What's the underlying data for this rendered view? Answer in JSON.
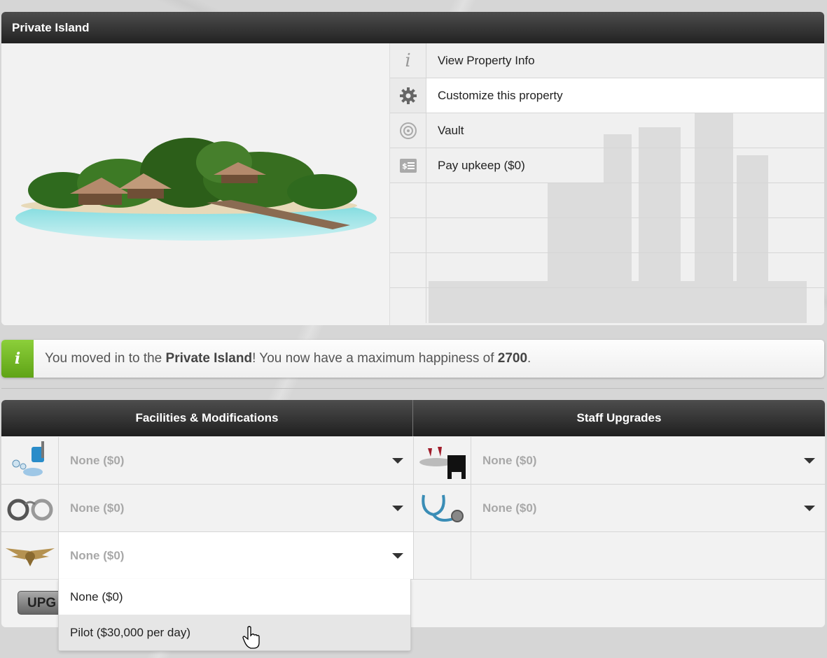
{
  "property": {
    "title": "Private Island",
    "menu": [
      {
        "icon": "info-icon",
        "label": "View Property Info"
      },
      {
        "icon": "gear-icon",
        "label": "Customize this property"
      },
      {
        "icon": "vault-icon",
        "label": "Vault"
      },
      {
        "icon": "upkeep-icon",
        "label": "Pay upkeep ($0)"
      }
    ]
  },
  "message": {
    "prefix": "You moved in to the ",
    "property_name": "Private Island",
    "middle": "! You now have a maximum happiness of ",
    "happiness": "2700",
    "suffix": "."
  },
  "upgrades": {
    "facilities_title": "Facilities & Modifications",
    "staff_title": "Staff Upgrades",
    "facilities": [
      {
        "icon": "cleaning-icon",
        "value": "None ($0)"
      },
      {
        "icon": "handcuffs-icon",
        "value": "None ($0)"
      },
      {
        "icon": "pilot-wings-icon",
        "value": "None ($0)"
      }
    ],
    "staff": [
      {
        "icon": "butler-icon",
        "value": "None ($0)"
      },
      {
        "icon": "stethoscope-icon",
        "value": "None ($0)"
      }
    ],
    "upgrade_button": "UPG",
    "dropdown_options": [
      "None ($0)",
      "Pilot ($30,000 per day)"
    ]
  }
}
